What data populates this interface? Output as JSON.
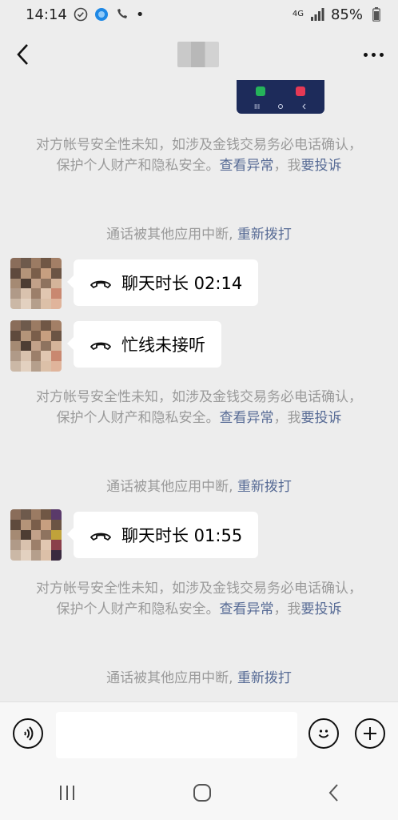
{
  "status_bar": {
    "time": "14:14",
    "network": "4G",
    "battery": "85%"
  },
  "header": {
    "back_icon": "chevron-left-icon",
    "more_icon": "more-icon"
  },
  "notice": {
    "text": "对方帐号安全性未知，如涉及金钱交易务必电话确认，保护个人财产和隐私安全。",
    "link_view": "查看异常",
    "sep": "，我",
    "link_report": "要投诉"
  },
  "interrupt": {
    "text": "通话被其他应用中断, ",
    "link": "重新拨打"
  },
  "calls": [
    {
      "label": "聊天时长 02:14"
    },
    {
      "label": "忙线未接听"
    },
    {
      "label": "聊天时长 01:55"
    }
  ]
}
